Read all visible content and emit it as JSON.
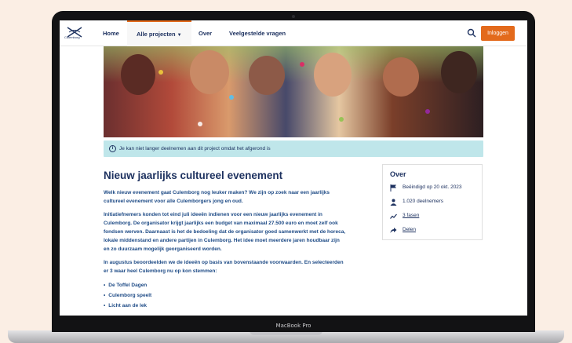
{
  "device": {
    "brand_label": "MacBook Pro"
  },
  "site": {
    "logo_text": "Culemborg",
    "nav": {
      "home": "Home",
      "projects": "Alle projecten",
      "about": "Over",
      "faq": "Veelgestelde vragen",
      "login": "Inloggen"
    }
  },
  "alert": {
    "text": "Je kan niet langer deelnemen aan dit project omdat het afgerond is"
  },
  "article": {
    "title": "Nieuw jaarlijks cultureel evenement",
    "intro": "Welk nieuw evenement gaat Culemborg nog leuker maken? We zijn op zoek naar een jaarlijks cultureel evenement voor alle Culemborgers jong en oud.",
    "para1": "Initiatiefnemers konden tot eind juli ideeën indienen voor een nieuw jaarlijks evenement in Culemborg. De organisator krijgt jaarlijks een budget van maximaal 27.500 euro en moet zelf ook fondsen werven. Daarnaast is het de bedoeling dat de organisator goed samenwerkt met de horeca, lokale middenstand en andere partijen in Culemborg. Het idee moet meerdere jaren houdbaar zijn en zo duurzaam mogelijk georganiseerd worden.",
    "para2": "In augustus beoordeelden we de ideeën op basis van bovenstaande voorwaarden. En selecteerden er 3 waar heel Culemborg nu op kon stemmen:",
    "options": [
      "De Toffel Dagen",
      "Culemborg speelt",
      "Licht aan de lek"
    ]
  },
  "about_card": {
    "title": "Over",
    "ended": "Beëindigd op 20 okt. 2023",
    "participants": "1.020 deelnemers",
    "phases": "3 fasen",
    "share": "Delen"
  },
  "colors": {
    "accent": "#e36a1c",
    "navy": "#1e3260",
    "alert_bg": "#bfe6ea"
  }
}
